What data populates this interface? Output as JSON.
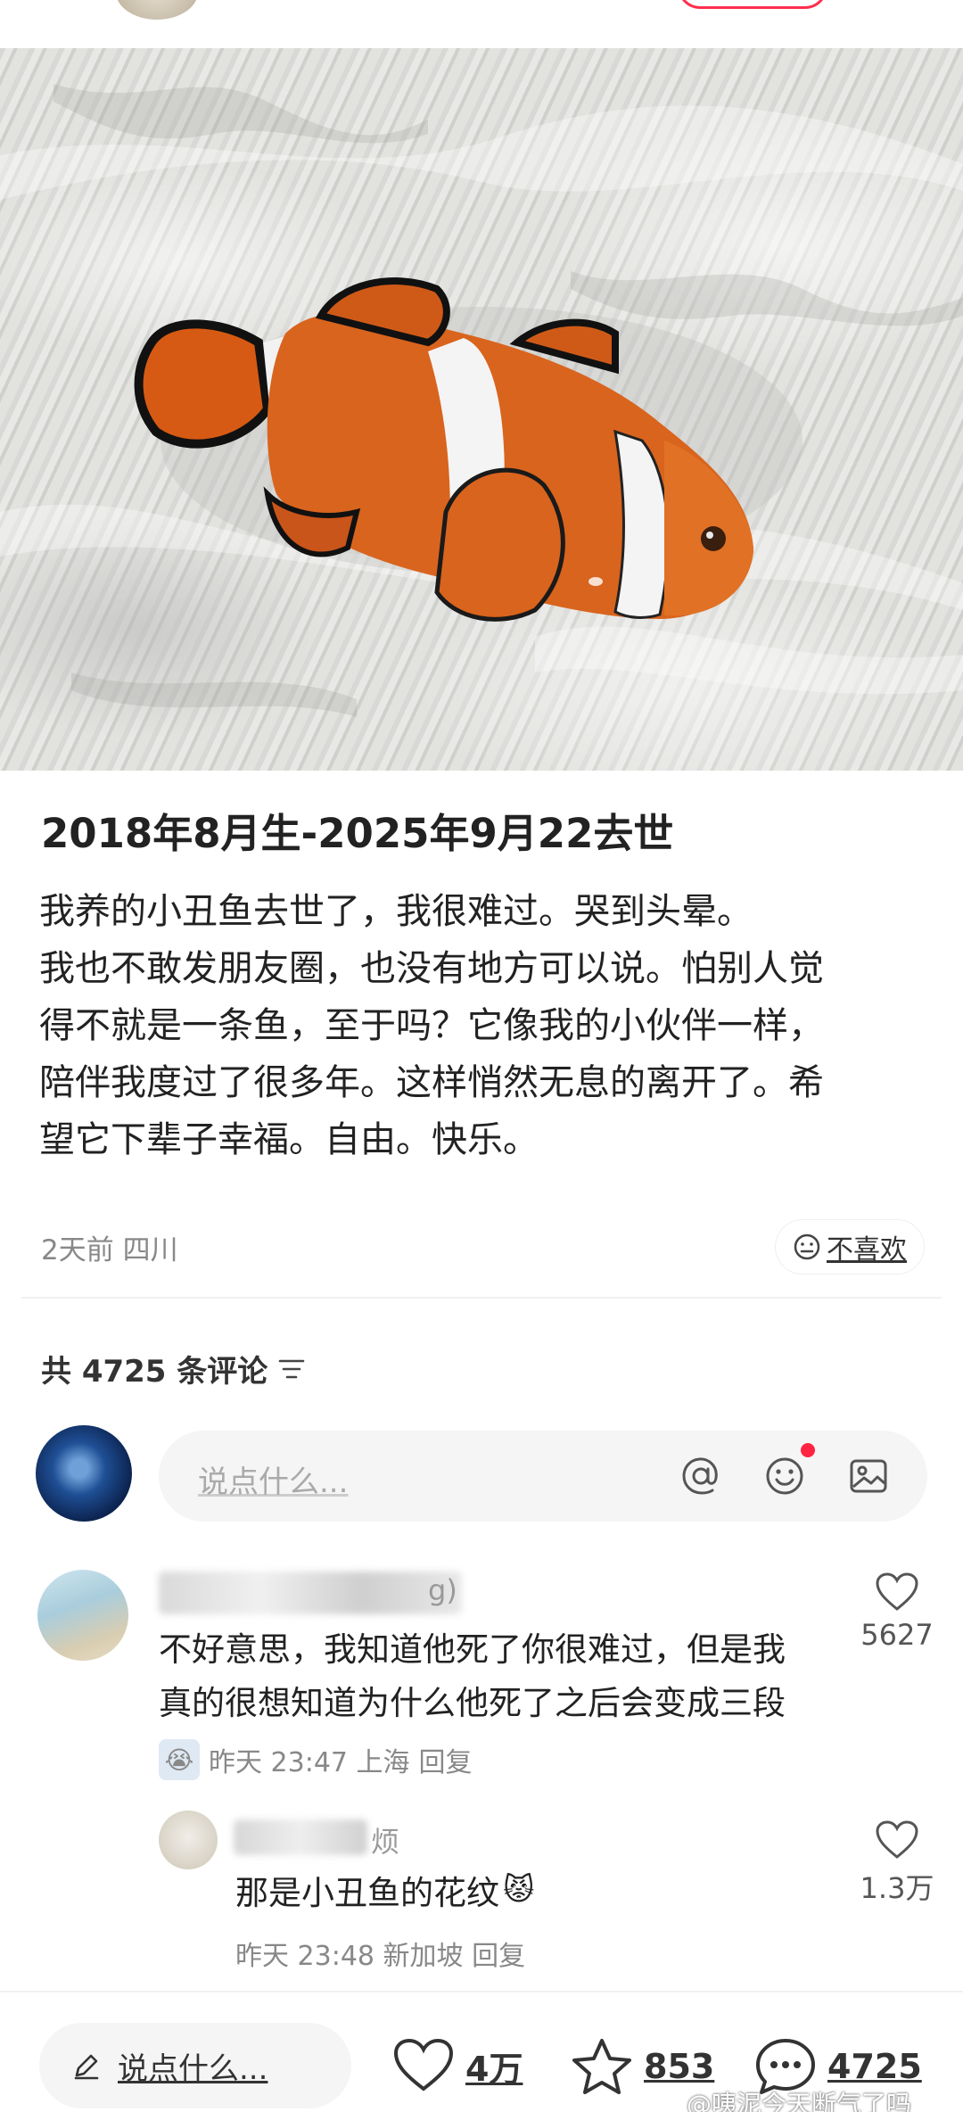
{
  "post": {
    "title": "2018年8月生-2025年9月22去世",
    "body_lines": [
      "我养的小丑鱼去世了，我很难过。哭到头晕。",
      "我也不敢发朋友圈，也没有地方可以说。怕别人觉",
      "得不就是一条鱼，至于吗？它像我的小伙伴一样，",
      "陪伴我度过了很多年。这样悄然无息的离开了。希",
      "望它下辈子幸福。自由。快乐。"
    ],
    "meta": "2天前 四川",
    "dislike_label": "不喜欢"
  },
  "comments_header": {
    "count_label": "共 4725 条评论"
  },
  "input": {
    "placeholder": "说点什么..."
  },
  "comments": [
    {
      "name_tail": "g)",
      "text_lines": [
        "不好意思，我知道他死了你很难过，但是我",
        "真的很想知道为什么他死了之后会变成三段"
      ],
      "meta": "昨天 23:47 上海",
      "reply": "回复",
      "likes": "5627"
    },
    {
      "name_tail": "烦",
      "text": "那是小丑鱼的花纹",
      "meta": "昨天 23:48 新加坡",
      "reply": "回复",
      "likes": "1.3万"
    }
  ],
  "bottom_bar": {
    "input_label": "说点什么...",
    "likes": "4万",
    "favorites": "853",
    "comments": "4725"
  },
  "watermark": "@咦泥今天断气了吗",
  "colors": {
    "accent": "#ff2442",
    "text": "#222222",
    "muted": "#888888"
  }
}
